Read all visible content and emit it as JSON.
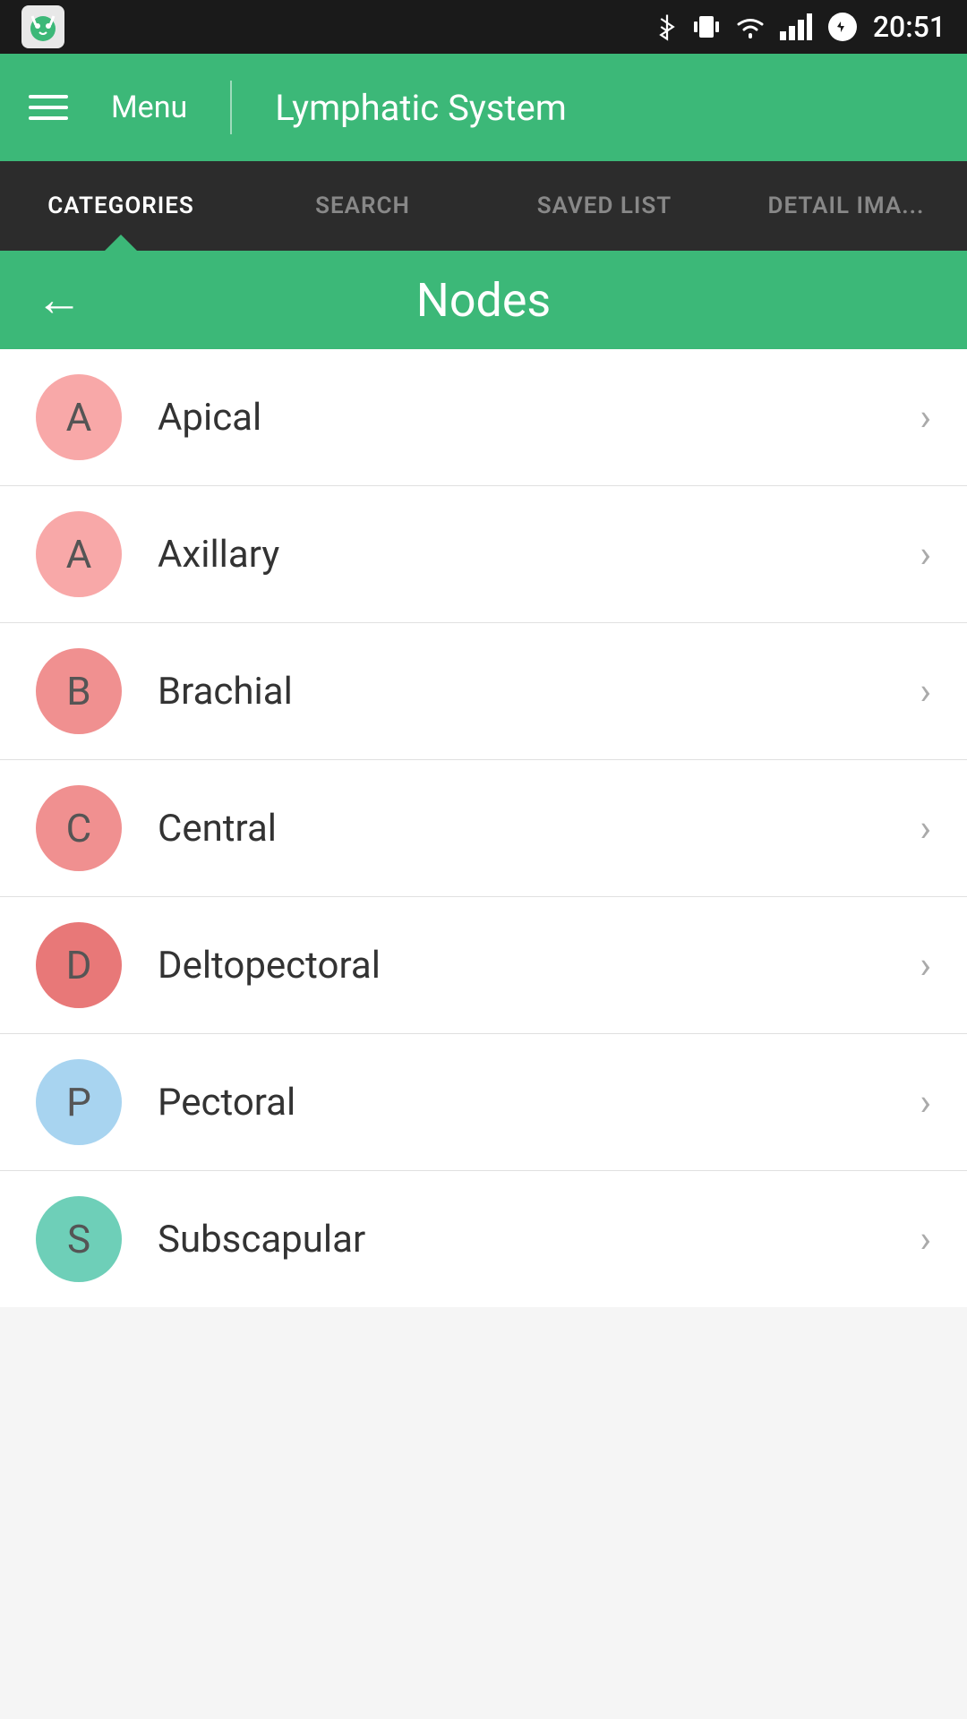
{
  "statusBar": {
    "time": "20:51",
    "appIconAlt": "app-icon"
  },
  "toolbar": {
    "menuLabel": "Menu",
    "title": "Lymphatic System",
    "divider": "|"
  },
  "tabs": [
    {
      "id": "categories",
      "label": "CATEGORIES",
      "active": true
    },
    {
      "id": "search",
      "label": "SEARCH",
      "active": false
    },
    {
      "id": "saved-list",
      "label": "SAVED LIST",
      "active": false
    },
    {
      "id": "detail-image",
      "label": "DETAIL IMA...",
      "active": false
    }
  ],
  "subHeader": {
    "backLabel": "←",
    "title": "Nodes"
  },
  "listItems": [
    {
      "id": "apical",
      "letter": "A",
      "label": "Apical",
      "avatarClass": "avatar-pink-light"
    },
    {
      "id": "axillary",
      "letter": "A",
      "label": "Axillary",
      "avatarClass": "avatar-pink-light"
    },
    {
      "id": "brachial",
      "letter": "B",
      "label": "Brachial",
      "avatarClass": "avatar-pink-medium"
    },
    {
      "id": "central",
      "letter": "C",
      "label": "Central",
      "avatarClass": "avatar-pink-medium"
    },
    {
      "id": "deltopectoral",
      "letter": "D",
      "label": "Deltopectoral",
      "avatarClass": "avatar-pink-darker"
    },
    {
      "id": "pectoral",
      "letter": "P",
      "label": "Pectoral",
      "avatarClass": "avatar-blue-light"
    },
    {
      "id": "subscapular",
      "letter": "S",
      "label": "Subscapular",
      "avatarClass": "avatar-teal-light"
    }
  ]
}
